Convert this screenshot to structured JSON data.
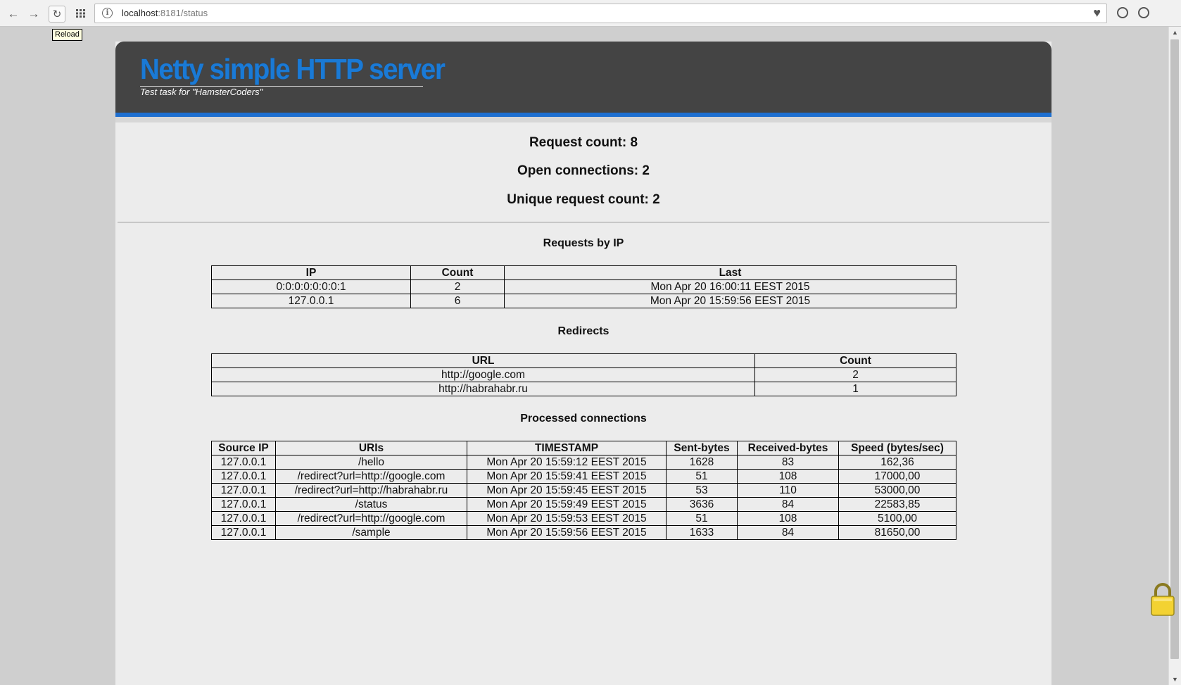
{
  "browser": {
    "url_host": "localhost",
    "url_rest": ":8181/status",
    "tooltip": "Reload"
  },
  "header": {
    "title": "Netty simple HTTP server",
    "subtitle": "Test task for \"HamsterCoders\""
  },
  "stats": {
    "request_count": "Request count: 8",
    "open_connections": "Open connections: 2",
    "unique_request_count": "Unique request count: 2"
  },
  "requests_by_ip": {
    "title": "Requests by IP",
    "columns": [
      "IP",
      "Count",
      "Last"
    ],
    "rows": [
      [
        "0:0:0:0:0:0:0:1",
        "2",
        "Mon Apr 20 16:00:11 EEST 2015"
      ],
      [
        "127.0.0.1",
        "6",
        "Mon Apr 20 15:59:56 EEST 2015"
      ]
    ]
  },
  "redirects": {
    "title": "Redirects",
    "columns": [
      "URL",
      "Count"
    ],
    "rows": [
      [
        "http://google.com",
        "2"
      ],
      [
        "http://habrahabr.ru",
        "1"
      ]
    ]
  },
  "processed_connections": {
    "title": "Processed connections",
    "columns": [
      "Source IP",
      "URIs",
      "TIMESTAMP",
      "Sent-bytes",
      "Received-bytes",
      "Speed (bytes/sec)"
    ],
    "rows": [
      [
        "127.0.0.1",
        "/hello",
        "Mon Apr 20 15:59:12 EEST 2015",
        "1628",
        "83",
        "162,36"
      ],
      [
        "127.0.0.1",
        "/redirect?url=http://google.com",
        "Mon Apr 20 15:59:41 EEST 2015",
        "51",
        "108",
        "17000,00"
      ],
      [
        "127.0.0.1",
        "/redirect?url=http://habrahabr.ru",
        "Mon Apr 20 15:59:45 EEST 2015",
        "53",
        "110",
        "53000,00"
      ],
      [
        "127.0.0.1",
        "/status",
        "Mon Apr 20 15:59:49 EEST 2015",
        "3636",
        "84",
        "22583,85"
      ],
      [
        "127.0.0.1",
        "/redirect?url=http://google.com",
        "Mon Apr 20 15:59:53 EEST 2015",
        "51",
        "108",
        "5100,00"
      ],
      [
        "127.0.0.1",
        "/sample",
        "Mon Apr 20 15:59:56 EEST 2015",
        "1633",
        "84",
        "81650,00"
      ]
    ]
  },
  "icons": {
    "back": "back-arrow-icon",
    "forward": "forward-arrow-icon",
    "reload": "reload-icon",
    "apps": "apps-grid-icon",
    "info": "site-info-icon",
    "bookmark": "heart-icon",
    "download": "download-icon",
    "profile": "profile-icon",
    "lock": "padlock-icon"
  },
  "colors": {
    "header_bg": "#444444",
    "title_blue": "#1a7ad6",
    "accent_bar": "#1e6fd0"
  }
}
